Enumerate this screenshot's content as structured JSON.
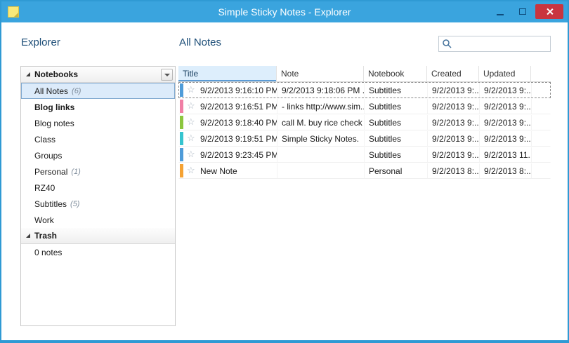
{
  "window": {
    "title": "Simple Sticky Notes - Explorer"
  },
  "icons": {
    "star": "☆"
  },
  "explorer": {
    "heading": "Explorer",
    "notebooks": {
      "header": "Notebooks",
      "items": [
        {
          "label": "All Notes",
          "count": "(6)",
          "selected": true
        },
        {
          "label": "Blog links",
          "bold": true
        },
        {
          "label": "Blog notes"
        },
        {
          "label": "Class"
        },
        {
          "label": "Groups"
        },
        {
          "label": "Personal",
          "count": "(1)"
        },
        {
          "label": "RZ40"
        },
        {
          "label": "Subtitles",
          "count": "(5)"
        },
        {
          "label": "Work"
        }
      ]
    },
    "trash": {
      "header": "Trash",
      "items": [
        {
          "label": "0 notes"
        }
      ]
    }
  },
  "main": {
    "heading": "All Notes",
    "search": {
      "value": "",
      "placeholder": ""
    },
    "table": {
      "columns": [
        "Title",
        "Note",
        "Notebook",
        "Created",
        "Updated"
      ],
      "rows": [
        {
          "color": "#4f9cd9",
          "title": "9/2/2013 9:16:10 PM",
          "note": "9/2/2013 9:18:06 PM  ...",
          "notebook": "Subtitles",
          "created": "9/2/2013 9:...",
          "updated": "9/2/2013 9:...",
          "selected": true
        },
        {
          "color": "#f07fa5",
          "title": "9/2/2013 9:16:51 PM",
          "note": "- links  http://www.sim...",
          "notebook": "Subtitles",
          "created": "9/2/2013 9:...",
          "updated": "9/2/2013 9:..."
        },
        {
          "color": "#8cc63e",
          "title": "9/2/2013 9:18:40 PM",
          "note": "call M. buy rice check c...",
          "notebook": "Subtitles",
          "created": "9/2/2013 9:...",
          "updated": "9/2/2013 9:..."
        },
        {
          "color": "#35c4cf",
          "title": "9/2/2013 9:19:51 PM",
          "note": "Simple Sticky Notes.",
          "notebook": "Subtitles",
          "created": "9/2/2013 9:...",
          "updated": "9/2/2013 9:..."
        },
        {
          "color": "#4f9cd9",
          "title": "9/2/2013 9:23:45 PM",
          "note": "",
          "notebook": "Subtitles",
          "created": "9/2/2013 9:...",
          "updated": "9/2/2013 11..."
        },
        {
          "color": "#f5a233",
          "title": "New Note",
          "note": "",
          "notebook": "Personal",
          "created": "9/2/2013 8:...",
          "updated": "9/2/2013 8:..."
        }
      ]
    }
  }
}
